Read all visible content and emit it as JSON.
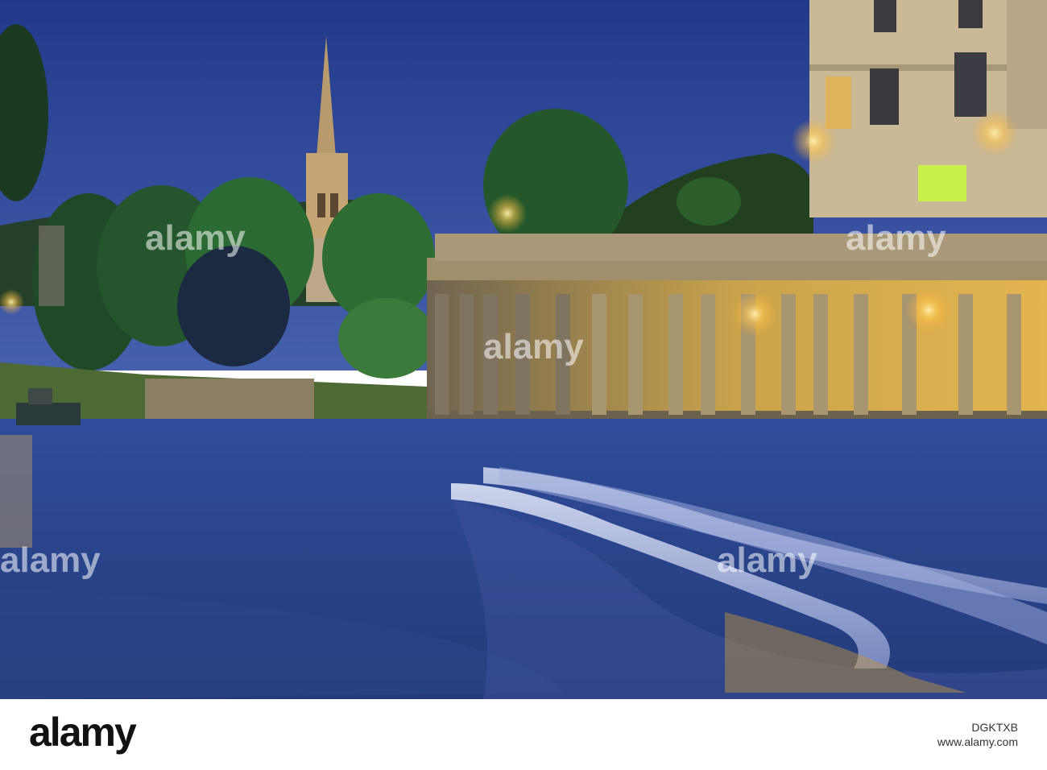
{
  "watermark": {
    "text": "alamy",
    "corner_mark": "a"
  },
  "footer": {
    "logo": "alamy",
    "url": "www.alamy.com",
    "image_id_line": "DGKTXB"
  },
  "colors": {
    "sky_top": "#233a88",
    "sky_bottom": "#3e5aa8",
    "river": "#3553a0",
    "lamp_glow": "#ffcc55",
    "stone": "#b9a781"
  }
}
